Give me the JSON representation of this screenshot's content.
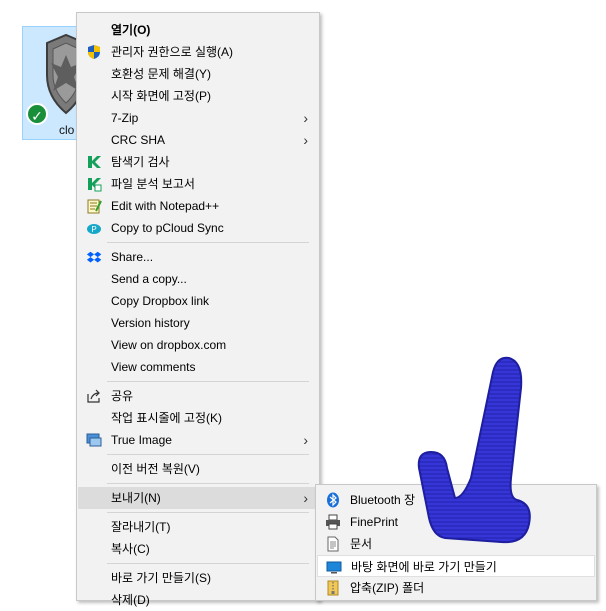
{
  "desktop": {
    "icon_label": "clo",
    "sync_status_icon": "green-check-icon"
  },
  "context_menu": {
    "items": [
      {
        "label": "열기(O)",
        "bold": true,
        "icon": null,
        "arrow": false
      },
      {
        "label": "관리자 권한으로 실행(A)",
        "icon": "uac-shield-icon",
        "arrow": false
      },
      {
        "label": "호환성 문제 해결(Y)",
        "icon": null,
        "arrow": false
      },
      {
        "label": "시작 화면에 고정(P)",
        "icon": null,
        "arrow": false
      },
      {
        "label": "7-Zip",
        "icon": null,
        "arrow": true
      },
      {
        "label": "CRC SHA",
        "icon": null,
        "arrow": true
      },
      {
        "label": "탐색기 검사",
        "icon": "kaspersky-icon",
        "arrow": false
      },
      {
        "label": "파일 분석 보고서",
        "icon": "kaspersky-report-icon",
        "arrow": false
      },
      {
        "label": "Edit with Notepad++",
        "icon": "notepad-plus-plus-icon",
        "arrow": false
      },
      {
        "label": "Copy to pCloud Sync",
        "icon": "pcloud-icon",
        "arrow": false
      },
      {
        "label": "Share...",
        "icon": "dropbox-icon",
        "arrow": false
      },
      {
        "label": "Send a copy...",
        "icon": null,
        "arrow": false
      },
      {
        "label": "Copy Dropbox link",
        "icon": null,
        "arrow": false
      },
      {
        "label": "Version history",
        "icon": null,
        "arrow": false
      },
      {
        "label": "View on dropbox.com",
        "icon": null,
        "arrow": false
      },
      {
        "label": "View comments",
        "icon": null,
        "arrow": false
      },
      {
        "label": "공유",
        "icon": "share-icon",
        "arrow": false
      },
      {
        "label": "작업 표시줄에 고정(K)",
        "icon": null,
        "arrow": false
      },
      {
        "label": "True Image",
        "icon": "true-image-icon",
        "arrow": true
      },
      {
        "label": "이전 버전 복원(V)",
        "icon": null,
        "arrow": false
      },
      {
        "label": "보내기(N)",
        "icon": null,
        "arrow": true,
        "highlighted": true
      },
      {
        "label": "잘라내기(T)",
        "icon": null,
        "arrow": false
      },
      {
        "label": "복사(C)",
        "icon": null,
        "arrow": false
      },
      {
        "label": "바로 가기 만들기(S)",
        "icon": null,
        "arrow": false
      },
      {
        "label": "삭제(D)",
        "icon": null,
        "arrow": false
      }
    ]
  },
  "send_to_submenu": {
    "items": [
      {
        "label": "Bluetooth 장",
        "icon": "bluetooth-icon"
      },
      {
        "label": "FinePrint",
        "icon": "printer-icon"
      },
      {
        "label": "문서",
        "icon": "document-icon"
      },
      {
        "label": "바탕 화면에 바로 가기 만들기",
        "icon": "desktop-icon",
        "highlighted": true
      },
      {
        "label": "압축(ZIP) 폴더",
        "icon": "zip-folder-icon"
      }
    ]
  },
  "overlay": {
    "icon": "pointing-hand-icon",
    "color": "#3535d8"
  }
}
